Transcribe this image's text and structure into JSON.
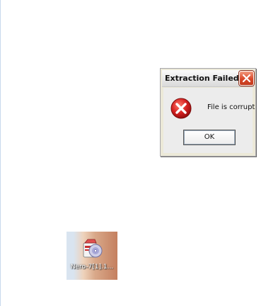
{
  "dialog": {
    "title": "Extraction Failed",
    "message": "File is corrupt",
    "ok_label": "OK",
    "close_icon": "close-icon",
    "status_icon": "error-icon"
  },
  "desktop": {
    "icon_label": "Nero-7[1].1...",
    "icon_name": "installer-package-icon"
  },
  "colors": {
    "close_button": "#d9482a",
    "error_red": "#d42020",
    "dialog_bg": "#ececec"
  }
}
